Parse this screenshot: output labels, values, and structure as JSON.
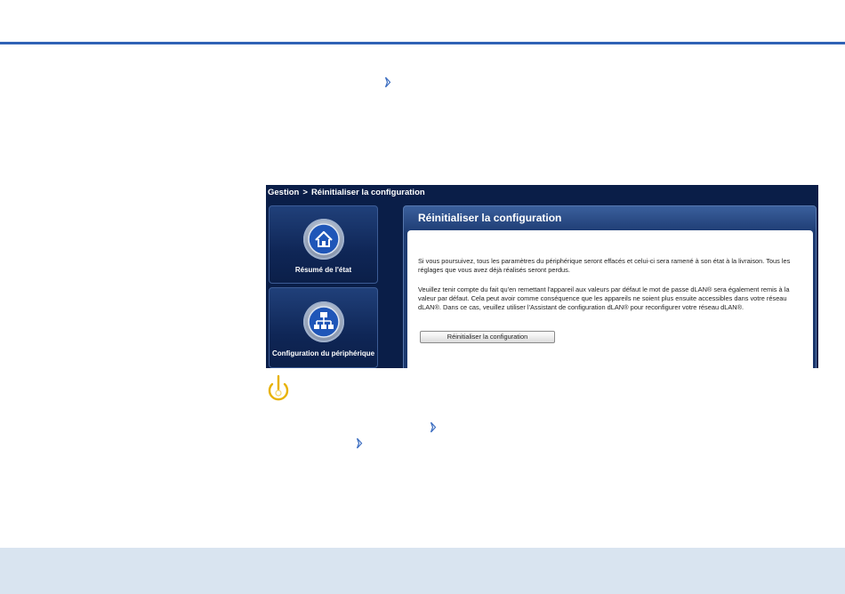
{
  "app": {
    "breadcrumb": {
      "root": "Gestion",
      "separator": ">",
      "current": "Réinitialiser la configuration"
    },
    "nav_tiles": [
      {
        "label": "Résumé de l'état",
        "icon": "home-icon"
      },
      {
        "label": "Configuration du périphérique",
        "icon": "network-icon"
      }
    ],
    "panel": {
      "title": "Réinitialiser la configuration",
      "paragraph_1": "Si vous poursuivez, tous les paramètres du périphérique seront effacés et celui-ci sera ramené à son état à la livraison. Tous les réglages que vous avez déjà réalisés seront perdus.",
      "paragraph_2": "Veuillez tenir compte du fait qu'en remettant l'appareil aux valeurs par défaut le mot de passe dLAN® sera également remis à la valeur par défaut. Cela peut avoir comme conséquence que les appareils ne soient plus ensuite accessibles dans votre réseau dLAN®. Dans ce cas, veuillez utiliser l'Assistant de configuration dLAN® pour reconfigurer votre réseau dLAN®.",
      "reset_button": "Réinitialiser la configuration"
    }
  },
  "icons": {
    "arrow": "arrow-right-icon",
    "power": "power-icon"
  },
  "colors": {
    "rule": "#2f62b5",
    "footer": "#d9e4f0",
    "app_background": "#0a1e48",
    "power_icon": "#e8b200"
  }
}
